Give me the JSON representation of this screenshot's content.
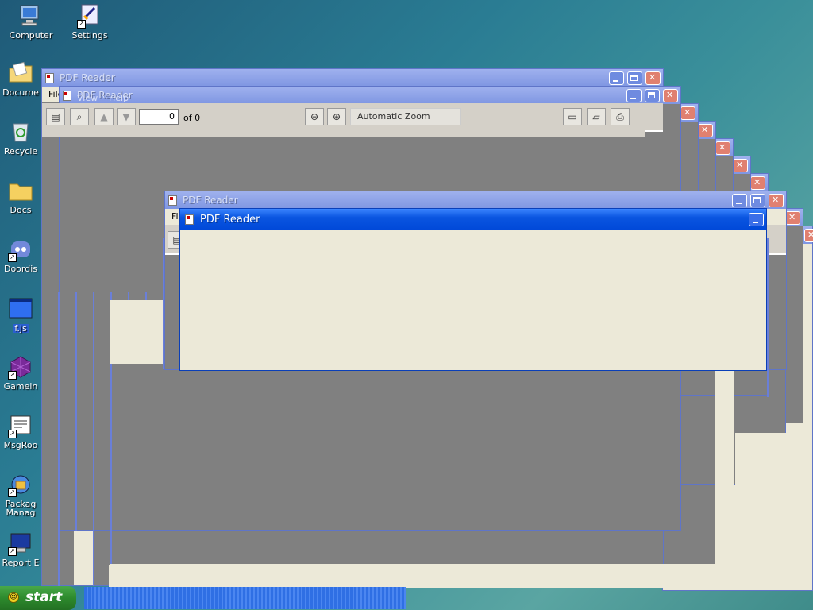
{
  "desktop": {
    "icons": [
      {
        "label": "Computer",
        "icon": "computer-icon"
      },
      {
        "label": "Settings",
        "icon": "settings-icon"
      },
      {
        "label": "Docume",
        "icon": "documents-folder-icon"
      },
      {
        "label": "Recycle",
        "icon": "recycle-bin-icon"
      },
      {
        "label": "Docs",
        "icon": "folder-icon"
      },
      {
        "label": "Doordis",
        "icon": "doordis-icon"
      },
      {
        "label": "f.js",
        "icon": "js-file-icon"
      },
      {
        "label": "Gamein",
        "icon": "game-icon"
      },
      {
        "label": "MsgRoo",
        "icon": "msgroom-icon"
      },
      {
        "label": "Packag\nManag",
        "icon": "package-manager-icon"
      },
      {
        "label": "Report E",
        "icon": "report-icon"
      }
    ]
  },
  "pdf_reader": {
    "title": "PDF Reader",
    "menu": [
      "File",
      "View",
      "Help"
    ],
    "page_number": "0",
    "page_count_label": "of 0",
    "zoom": "Automatic Zoom",
    "toolbar_icons": [
      "sidebar-toggle-icon",
      "find-icon",
      "previous-page-icon",
      "next-page-icon",
      "zoom-out-icon",
      "zoom-in-icon",
      "presentation-icon",
      "open-file-icon",
      "print-icon"
    ]
  },
  "taskbar": {
    "start_label": "start"
  },
  "colors": {
    "active_title": "#0a55e0",
    "inactive_title": "#8a9fe6",
    "viewer_bg": "#808080",
    "panel": "#ece9d8"
  }
}
